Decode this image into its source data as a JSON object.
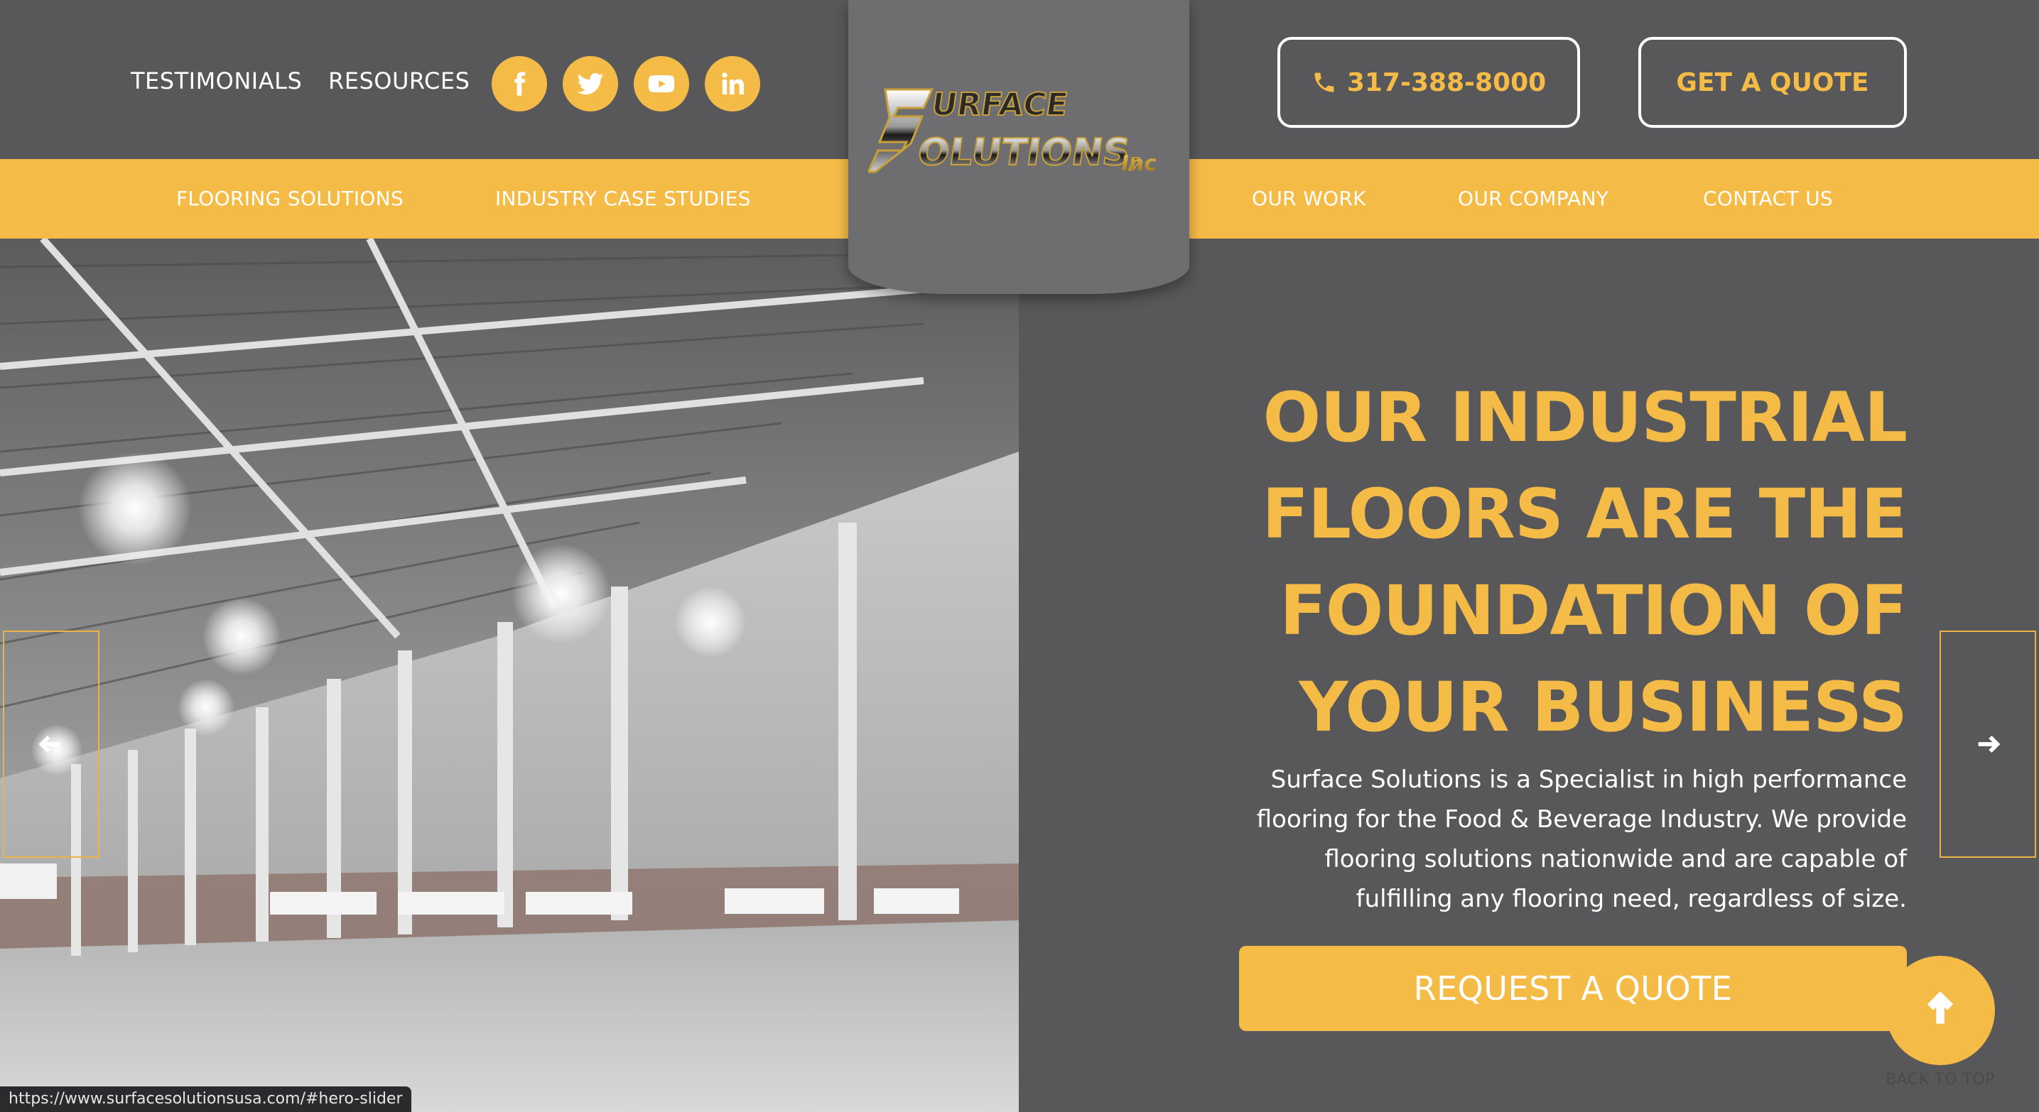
{
  "header": {
    "top_links": [
      "TESTIMONIALS",
      "RESOURCES"
    ],
    "social_icons": [
      "facebook-icon",
      "twitter-icon",
      "youtube-icon",
      "linkedin-icon"
    ],
    "phone": "317-388-8000",
    "quote_button": "GET A QUOTE"
  },
  "logo": {
    "line1": "URFACE",
    "line2": "OLUTIONS,",
    "suffix": "Inc"
  },
  "nav": {
    "left": [
      "FLOORING SOLUTIONS",
      "INDUSTRY CASE STUDIES"
    ],
    "right": [
      "OUR WORK",
      "OUR COMPANY",
      "CONTACT US"
    ]
  },
  "hero": {
    "title_lines": [
      "OUR INDUSTRIAL",
      "FLOORS ARE THE",
      "FOUNDATION OF",
      "YOUR BUSINESS"
    ],
    "text_lines": [
      "Surface Solutions is a Specialist in high performance",
      "flooring for the Food & Beverage Industry. We provide",
      "flooring solutions nationwide and are capable of",
      "fulfilling any flooring need, regardless of size."
    ],
    "cta": "REQUEST A QUOTE",
    "image_alt": "Empty industrial warehouse interior"
  },
  "back_to_top": "BACK TO TOP",
  "status_url": "https://www.surfacesolutionsusa.com/#hero-slider",
  "colors": {
    "accent": "#f5bb47",
    "background": "#58585a",
    "logo_plate": "#6e6e70"
  }
}
